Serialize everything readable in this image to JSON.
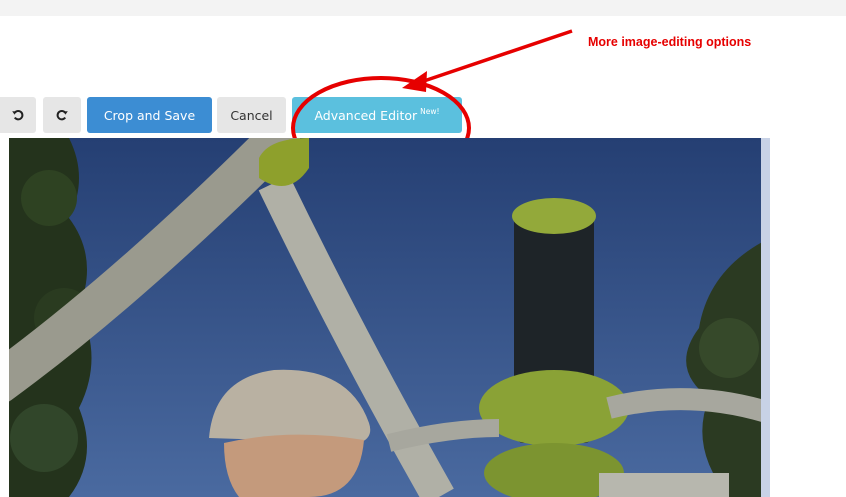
{
  "toolbar": {
    "undo": {
      "icon": "rotate-left-icon"
    },
    "redo": {
      "icon": "rotate-right-icon"
    },
    "crop_save_label": "Crop and Save",
    "cancel_label": "Cancel",
    "advanced_label": "Advanced Editor",
    "advanced_badge": "New!"
  },
  "annotation": {
    "text": "More image-editing options",
    "color": "#e60000"
  },
  "colors": {
    "crop_button": "#3c8dd3",
    "advanced_button": "#5bc0de",
    "annotation_red": "#e60000"
  }
}
